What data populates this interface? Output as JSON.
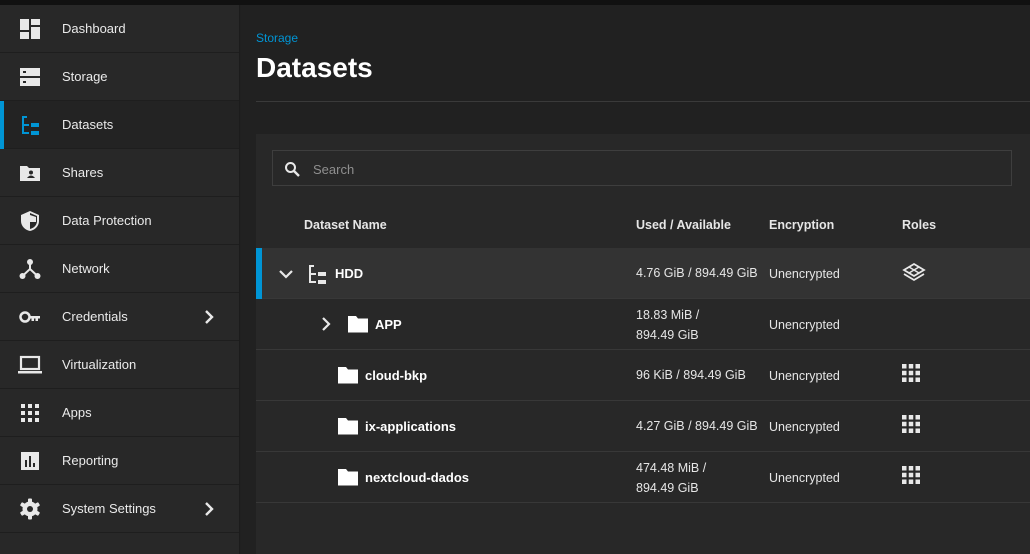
{
  "sidebar": {
    "items": [
      {
        "label": "Dashboard",
        "icon": "dashboard-icon"
      },
      {
        "label": "Storage",
        "icon": "storage-icon"
      },
      {
        "label": "Datasets",
        "icon": "datasets-icon",
        "active": true
      },
      {
        "label": "Shares",
        "icon": "shares-folder-icon"
      },
      {
        "label": "Data Protection",
        "icon": "shield-icon"
      },
      {
        "label": "Network",
        "icon": "network-icon"
      },
      {
        "label": "Credentials",
        "icon": "key-icon",
        "has_submenu": true
      },
      {
        "label": "Virtualization",
        "icon": "laptop-icon"
      },
      {
        "label": "Apps",
        "icon": "apps-grid-icon"
      },
      {
        "label": "Reporting",
        "icon": "reporting-icon"
      },
      {
        "label": "System Settings",
        "icon": "gear-icon",
        "has_submenu": true
      }
    ]
  },
  "header": {
    "breadcrumb": "Storage",
    "title": "Datasets"
  },
  "search": {
    "placeholder": "Search",
    "value": ""
  },
  "table": {
    "columns": {
      "name": "Dataset Name",
      "used": "Used / Available",
      "encryption": "Encryption",
      "roles": "Roles"
    },
    "rows": [
      {
        "name": "HDD",
        "used_line1": "4.76 GiB / 894.49 GiB",
        "used_line2": "",
        "encryption": "Unencrypted",
        "role_icon": "pool-role-icon",
        "expanded": true,
        "selected": true
      },
      {
        "name": "APP",
        "used_line1": "18.83 MiB /",
        "used_line2": "894.49 GiB",
        "encryption": "Unencrypted",
        "role_icon": "",
        "expanded": false
      },
      {
        "name": "cloud-bkp",
        "used_line1": "96 KiB / 894.49 GiB",
        "used_line2": "",
        "encryption": "Unencrypted",
        "role_icon": "apps-role-icon"
      },
      {
        "name": "ix-applications",
        "used_line1": "4.27 GiB / 894.49 GiB",
        "used_line2": "",
        "encryption": "Unencrypted",
        "role_icon": "apps-role-icon"
      },
      {
        "name": "nextcloud-dados",
        "used_line1": "474.48 MiB /",
        "used_line2": "894.49 GiB",
        "encryption": "Unencrypted",
        "role_icon": "apps-role-icon"
      }
    ]
  },
  "colors": {
    "accent": "#0095d5",
    "sidebar_bg": "#282828",
    "main_bg": "#212121",
    "panel_bg": "#282828",
    "selected_row_bg": "#333333"
  }
}
